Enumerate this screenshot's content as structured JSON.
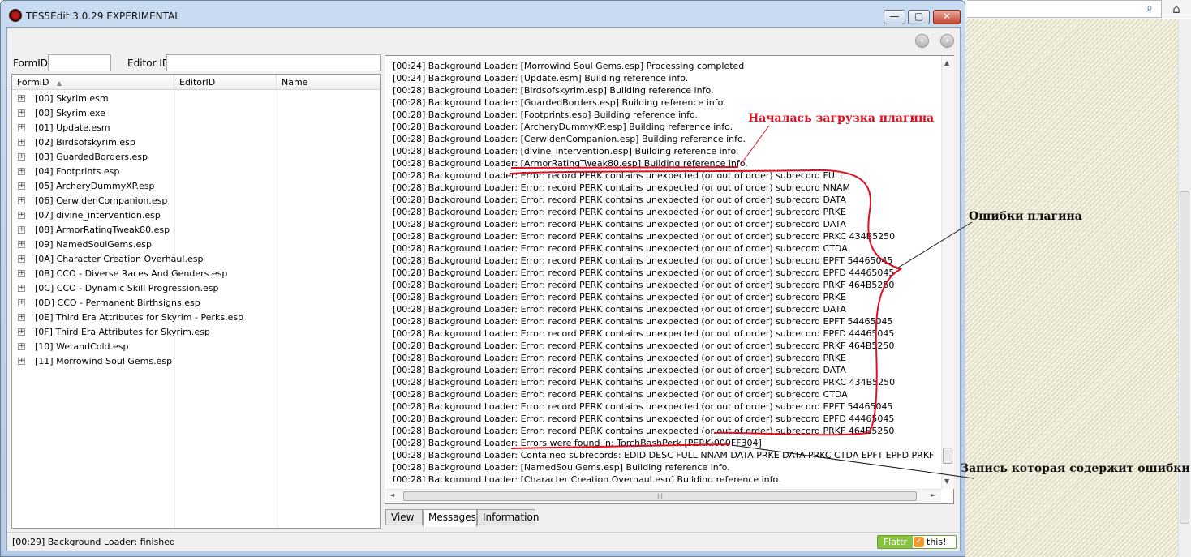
{
  "window": {
    "title": "TES5Edit 3.0.29 EXPERIMENTAL",
    "minimize_glyph": "—",
    "maximize_glyph": "▢",
    "close_glyph": "✕"
  },
  "nav": {
    "back_glyph": "‹",
    "forward_glyph": "›"
  },
  "filters": {
    "formid_label": "FormID",
    "formid_value": "",
    "editorid_label": "Editor ID",
    "editorid_value": ""
  },
  "tree": {
    "columns": [
      "FormID",
      "EditorID",
      "Name"
    ],
    "sort_glyph": "▲",
    "expander_glyph": "+",
    "items": [
      "[00] Skyrim.esm",
      "[00] Skyrim.exe",
      "[01] Update.esm",
      "[02] Birdsofskyrim.esp",
      "[03] GuardedBorders.esp",
      "[04] Footprints.esp",
      "[05] ArcheryDummyXP.esp",
      "[06] CerwidenCompanion.esp",
      "[07] divine_intervention.esp",
      "[08] ArmorRatingTweak80.esp",
      "[09] NamedSoulGems.esp",
      "[0A] Character Creation Overhaul.esp",
      "[0B] CCO - Diverse Races And Genders.esp",
      "[0C] CCO - Dynamic Skill Progression.esp",
      "[0D] CCO - Permanent Birthsigns.esp",
      "[0E] Third Era Attributes for Skyrim - Perks.esp",
      "[0F] Third Era Attributes for Skyrim.esp",
      "[10] WetandCold.esp",
      "[11] Morrowind Soul Gems.esp"
    ]
  },
  "messages": [
    "[00:24] Background Loader: [Morrowind Soul Gems.esp] Processing completed",
    "[00:24] Background Loader: [Update.esm] Building reference info.",
    "[00:28] Background Loader: [Birdsofskyrim.esp] Building reference info.",
    "[00:28] Background Loader: [GuardedBorders.esp] Building reference info.",
    "[00:28] Background Loader: [Footprints.esp] Building reference info.",
    "[00:28] Background Loader: [ArcheryDummyXP.esp] Building reference info.",
    "[00:28] Background Loader: [CerwidenCompanion.esp] Building reference info.",
    "[00:28] Background Loader: [divine_intervention.esp] Building reference info.",
    "[00:28] Background Loader: [ArmorRatingTweak80.esp] Building reference info.",
    "[00:28] Background Loader: Error: record PERK contains unexpected (or out of order) subrecord FULL",
    "[00:28] Background Loader: Error: record PERK contains unexpected (or out of order) subrecord NNAM",
    "[00:28] Background Loader: Error: record PERK contains unexpected (or out of order) subrecord DATA",
    "[00:28] Background Loader: Error: record PERK contains unexpected (or out of order) subrecord PRKE",
    "[00:28] Background Loader: Error: record PERK contains unexpected (or out of order) subrecord DATA",
    "[00:28] Background Loader: Error: record PERK contains unexpected (or out of order) subrecord PRKC 434B5250",
    "[00:28] Background Loader: Error: record PERK contains unexpected (or out of order) subrecord CTDA",
    "[00:28] Background Loader: Error: record PERK contains unexpected (or out of order) subrecord EPFT 54465045",
    "[00:28] Background Loader: Error: record PERK contains unexpected (or out of order) subrecord EPFD 44465045",
    "[00:28] Background Loader: Error: record PERK contains unexpected (or out of order) subrecord PRKF 464B5250",
    "[00:28] Background Loader: Error: record PERK contains unexpected (or out of order) subrecord PRKE",
    "[00:28] Background Loader: Error: record PERK contains unexpected (or out of order) subrecord DATA",
    "[00:28] Background Loader: Error: record PERK contains unexpected (or out of order) subrecord EPFT 54465045",
    "[00:28] Background Loader: Error: record PERK contains unexpected (or out of order) subrecord EPFD 44465045",
    "[00:28] Background Loader: Error: record PERK contains unexpected (or out of order) subrecord PRKF 464B5250",
    "[00:28] Background Loader: Error: record PERK contains unexpected (or out of order) subrecord PRKE",
    "[00:28] Background Loader: Error: record PERK contains unexpected (or out of order) subrecord DATA",
    "[00:28] Background Loader: Error: record PERK contains unexpected (or out of order) subrecord PRKC 434B5250",
    "[00:28] Background Loader: Error: record PERK contains unexpected (or out of order) subrecord CTDA",
    "[00:28] Background Loader: Error: record PERK contains unexpected (or out of order) subrecord EPFT 54465045",
    "[00:28] Background Loader: Error: record PERK contains unexpected (or out of order) subrecord EPFD 44465045",
    "[00:28] Background Loader: Error: record PERK contains unexpected (or out of order) subrecord PRKF 464B5250",
    "[00:28] Background Loader: Errors were found in: TorchBashPerk [PERK:000FF304]",
    "[00:28] Background Loader: Contained subrecords: EDID DESC FULL NNAM DATA PRKE DATA PRKC CTDA EPFT EPFD PRKF PRK",
    "[00:28] Background Loader: [NamedSoulGems.esp] Building reference info.",
    "[00:28] Background Loader: [Character Creation Overhaul.esp] Building reference info."
  ],
  "scroll": {
    "up": "▲",
    "down": "▼",
    "left": "◄",
    "right": "►",
    "grip": "|||"
  },
  "tabs": [
    "View",
    "Messages",
    "Information"
  ],
  "status": {
    "text": "[00:29] Background Loader: finished",
    "flattr_label": "Flattr",
    "flattr_suffix": "this!",
    "flattr_icon": "✓"
  },
  "annotations": {
    "plugin_load_start": "Началась загрузка плагина",
    "plugin_errors": "Ошибки плагина",
    "error_record": "Запись которая содержит ошибки",
    "color": "#e01020"
  },
  "browser": {
    "search_icon": "⌕",
    "home_icon": "⌂"
  }
}
